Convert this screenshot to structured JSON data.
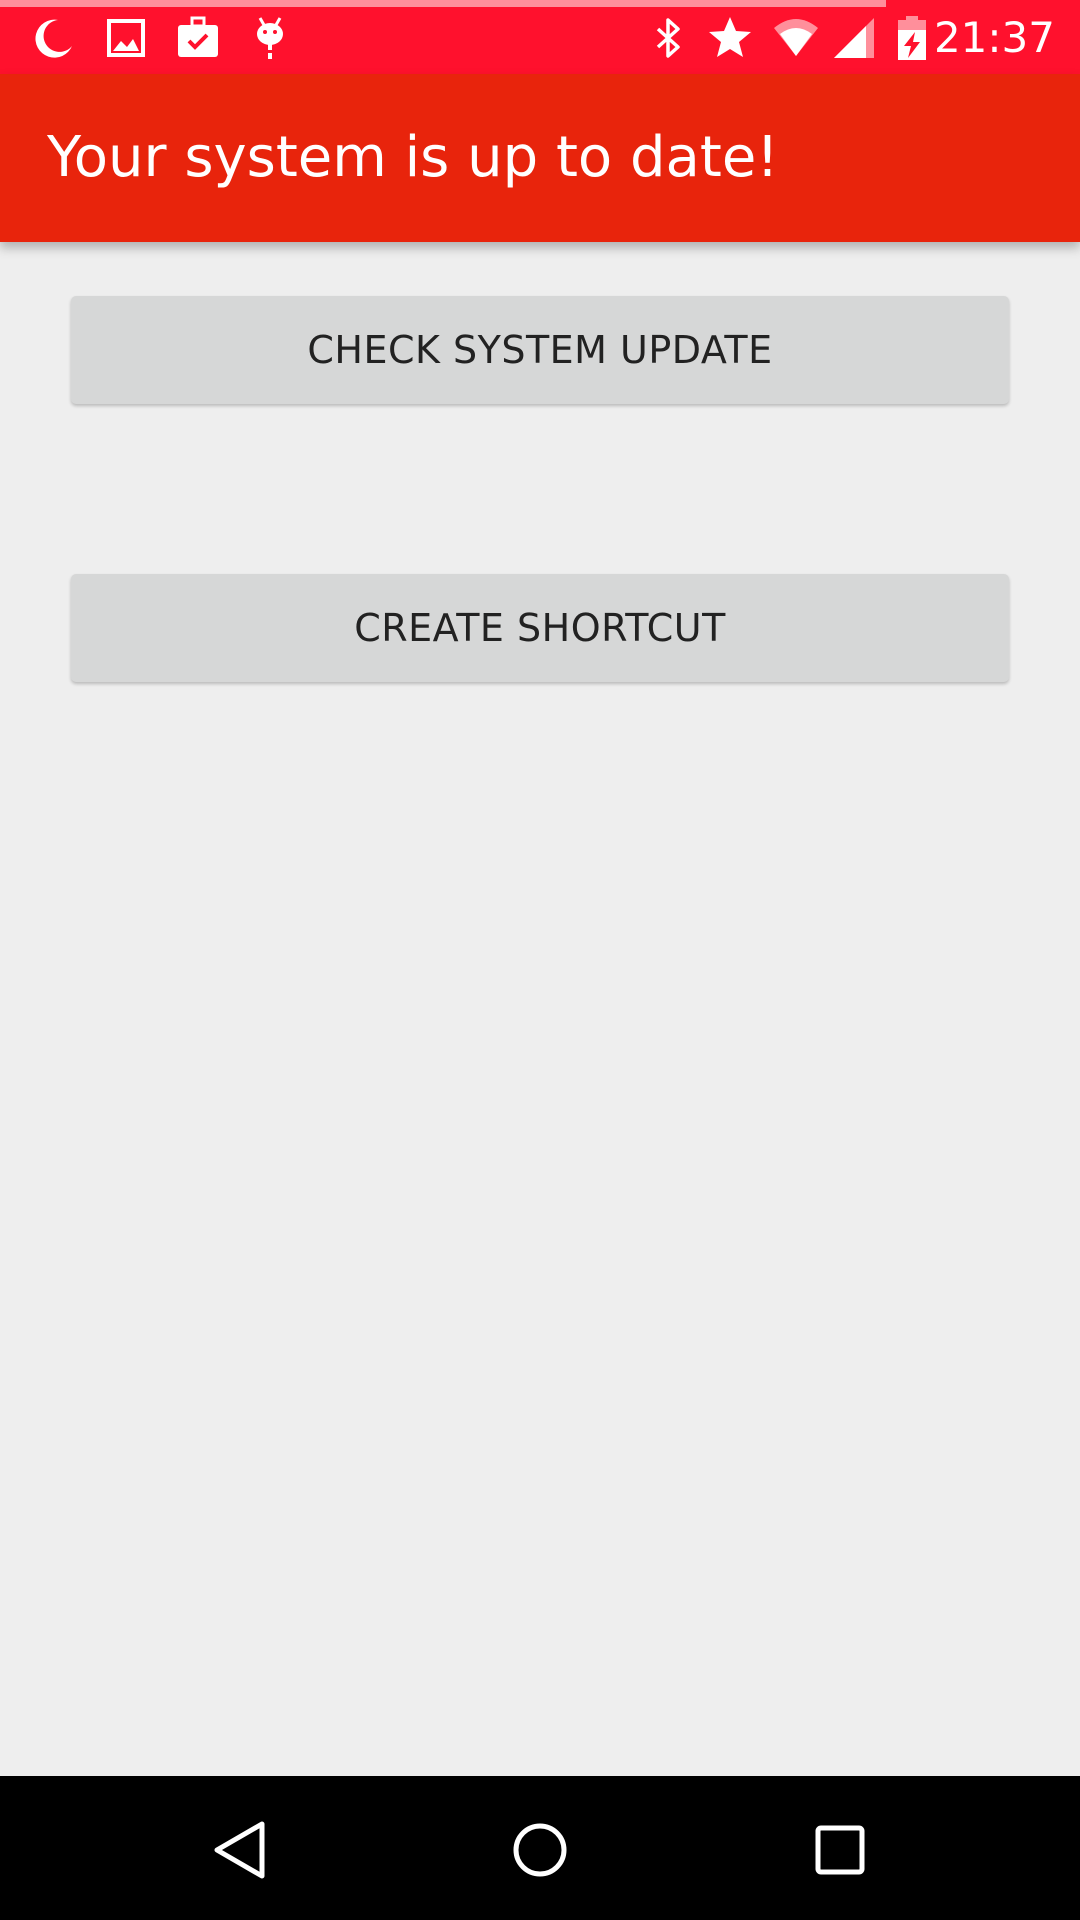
{
  "status_bar": {
    "time": "21:37",
    "color": "#ff112d",
    "progress_fraction": 0.82,
    "left_icons": [
      "moon-icon",
      "image-icon",
      "briefcase-check-icon",
      "android-debug-icon"
    ],
    "right_icons": [
      "bluetooth-icon",
      "star-icon",
      "wifi-icon",
      "cell-signal-icon",
      "battery-charging-icon"
    ]
  },
  "app_bar": {
    "title": "Your system is up to date!",
    "color": "#e8240c"
  },
  "buttons": {
    "check_update": "CHECK SYSTEM UPDATE",
    "create_shortcut": "CREATE SHORTCUT"
  },
  "nav_bar": {
    "icons": [
      "back-icon",
      "home-icon",
      "recents-icon"
    ]
  }
}
